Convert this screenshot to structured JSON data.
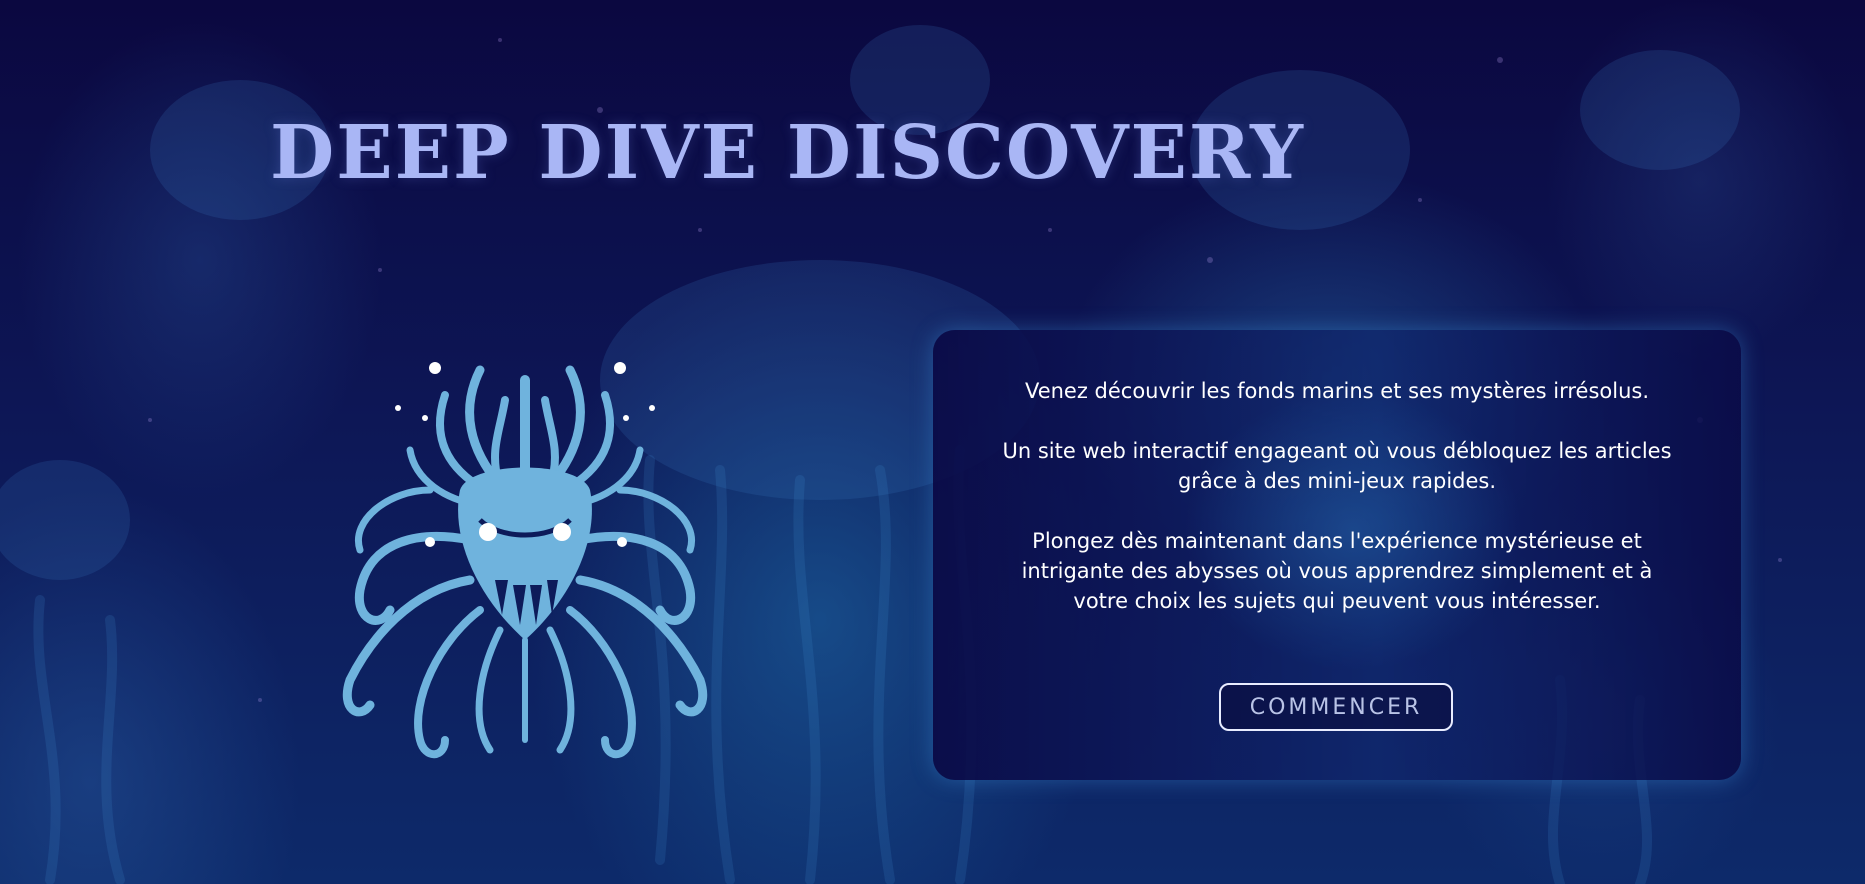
{
  "header": {
    "title": "DEEP DIVE DISCOVERY"
  },
  "illustration": {
    "icon": "abyssal-creature-icon"
  },
  "intro_card": {
    "paragraph_1": "Venez découvrir les fonds marins et ses mystères irrésolus.",
    "paragraph_2": "Un site web interactif engageant où vous débloquez les articles grâce à des mini-jeux rapides.",
    "paragraph_3": "Plongez dès maintenant dans l'expérience mystérieuse et intrigante des abysses où vous apprendrez simplement et à votre choix les sujets qui peuvent vous intéresser.",
    "start_button": "COMMENCER"
  },
  "colors": {
    "background": "#0b0840",
    "title": "#a9b6f5",
    "creature": "#6fb3dd",
    "card_glow": "#3c8cd2"
  }
}
